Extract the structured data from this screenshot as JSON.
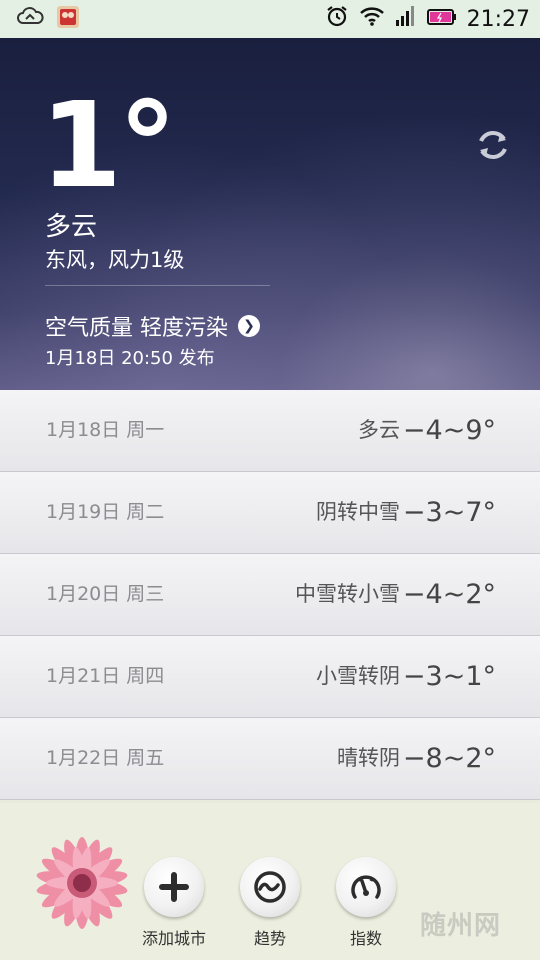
{
  "status_bar": {
    "time": "21:27"
  },
  "hero": {
    "temperature": "1°",
    "condition": "多云",
    "wind": "东风，风力1级",
    "air_quality": "空气质量 轻度污染",
    "publish_time": "1月18日 20:50 发布"
  },
  "forecast": [
    {
      "date": "1月18日 周一",
      "condition": "多云",
      "range": "−4~9°"
    },
    {
      "date": "1月19日 周二",
      "condition": "阴转中雪",
      "range": "−3~7°"
    },
    {
      "date": "1月20日 周三",
      "condition": "中雪转小雪",
      "range": "−4~2°"
    },
    {
      "date": "1月21日 周四",
      "condition": "小雪转阴",
      "range": "−3~1°"
    },
    {
      "date": "1月22日 周五",
      "condition": "晴转阴",
      "range": "−8~2°"
    }
  ],
  "dock": {
    "add_city": "添加城市",
    "trend": "趋势",
    "index": "指数"
  },
  "watermark": "随州网"
}
